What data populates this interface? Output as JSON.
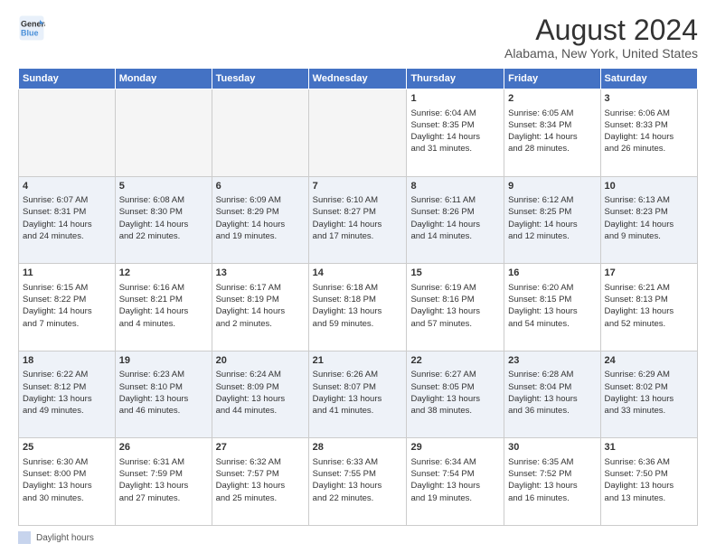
{
  "header": {
    "logo_line1": "General",
    "logo_line2": "Blue",
    "title": "August 2024",
    "subtitle": "Alabama, New York, United States"
  },
  "days_of_week": [
    "Sunday",
    "Monday",
    "Tuesday",
    "Wednesday",
    "Thursday",
    "Friday",
    "Saturday"
  ],
  "footer": {
    "label": "Daylight hours"
  },
  "weeks": [
    {
      "days": [
        {
          "num": "",
          "info": ""
        },
        {
          "num": "",
          "info": ""
        },
        {
          "num": "",
          "info": ""
        },
        {
          "num": "",
          "info": ""
        },
        {
          "num": "1",
          "info": "Sunrise: 6:04 AM\nSunset: 8:35 PM\nDaylight: 14 hours\nand 31 minutes."
        },
        {
          "num": "2",
          "info": "Sunrise: 6:05 AM\nSunset: 8:34 PM\nDaylight: 14 hours\nand 28 minutes."
        },
        {
          "num": "3",
          "info": "Sunrise: 6:06 AM\nSunset: 8:33 PM\nDaylight: 14 hours\nand 26 minutes."
        }
      ]
    },
    {
      "days": [
        {
          "num": "4",
          "info": "Sunrise: 6:07 AM\nSunset: 8:31 PM\nDaylight: 14 hours\nand 24 minutes."
        },
        {
          "num": "5",
          "info": "Sunrise: 6:08 AM\nSunset: 8:30 PM\nDaylight: 14 hours\nand 22 minutes."
        },
        {
          "num": "6",
          "info": "Sunrise: 6:09 AM\nSunset: 8:29 PM\nDaylight: 14 hours\nand 19 minutes."
        },
        {
          "num": "7",
          "info": "Sunrise: 6:10 AM\nSunset: 8:27 PM\nDaylight: 14 hours\nand 17 minutes."
        },
        {
          "num": "8",
          "info": "Sunrise: 6:11 AM\nSunset: 8:26 PM\nDaylight: 14 hours\nand 14 minutes."
        },
        {
          "num": "9",
          "info": "Sunrise: 6:12 AM\nSunset: 8:25 PM\nDaylight: 14 hours\nand 12 minutes."
        },
        {
          "num": "10",
          "info": "Sunrise: 6:13 AM\nSunset: 8:23 PM\nDaylight: 14 hours\nand 9 minutes."
        }
      ]
    },
    {
      "days": [
        {
          "num": "11",
          "info": "Sunrise: 6:15 AM\nSunset: 8:22 PM\nDaylight: 14 hours\nand 7 minutes."
        },
        {
          "num": "12",
          "info": "Sunrise: 6:16 AM\nSunset: 8:21 PM\nDaylight: 14 hours\nand 4 minutes."
        },
        {
          "num": "13",
          "info": "Sunrise: 6:17 AM\nSunset: 8:19 PM\nDaylight: 14 hours\nand 2 minutes."
        },
        {
          "num": "14",
          "info": "Sunrise: 6:18 AM\nSunset: 8:18 PM\nDaylight: 13 hours\nand 59 minutes."
        },
        {
          "num": "15",
          "info": "Sunrise: 6:19 AM\nSunset: 8:16 PM\nDaylight: 13 hours\nand 57 minutes."
        },
        {
          "num": "16",
          "info": "Sunrise: 6:20 AM\nSunset: 8:15 PM\nDaylight: 13 hours\nand 54 minutes."
        },
        {
          "num": "17",
          "info": "Sunrise: 6:21 AM\nSunset: 8:13 PM\nDaylight: 13 hours\nand 52 minutes."
        }
      ]
    },
    {
      "days": [
        {
          "num": "18",
          "info": "Sunrise: 6:22 AM\nSunset: 8:12 PM\nDaylight: 13 hours\nand 49 minutes."
        },
        {
          "num": "19",
          "info": "Sunrise: 6:23 AM\nSunset: 8:10 PM\nDaylight: 13 hours\nand 46 minutes."
        },
        {
          "num": "20",
          "info": "Sunrise: 6:24 AM\nSunset: 8:09 PM\nDaylight: 13 hours\nand 44 minutes."
        },
        {
          "num": "21",
          "info": "Sunrise: 6:26 AM\nSunset: 8:07 PM\nDaylight: 13 hours\nand 41 minutes."
        },
        {
          "num": "22",
          "info": "Sunrise: 6:27 AM\nSunset: 8:05 PM\nDaylight: 13 hours\nand 38 minutes."
        },
        {
          "num": "23",
          "info": "Sunrise: 6:28 AM\nSunset: 8:04 PM\nDaylight: 13 hours\nand 36 minutes."
        },
        {
          "num": "24",
          "info": "Sunrise: 6:29 AM\nSunset: 8:02 PM\nDaylight: 13 hours\nand 33 minutes."
        }
      ]
    },
    {
      "days": [
        {
          "num": "25",
          "info": "Sunrise: 6:30 AM\nSunset: 8:00 PM\nDaylight: 13 hours\nand 30 minutes."
        },
        {
          "num": "26",
          "info": "Sunrise: 6:31 AM\nSunset: 7:59 PM\nDaylight: 13 hours\nand 27 minutes."
        },
        {
          "num": "27",
          "info": "Sunrise: 6:32 AM\nSunset: 7:57 PM\nDaylight: 13 hours\nand 25 minutes."
        },
        {
          "num": "28",
          "info": "Sunrise: 6:33 AM\nSunset: 7:55 PM\nDaylight: 13 hours\nand 22 minutes."
        },
        {
          "num": "29",
          "info": "Sunrise: 6:34 AM\nSunset: 7:54 PM\nDaylight: 13 hours\nand 19 minutes."
        },
        {
          "num": "30",
          "info": "Sunrise: 6:35 AM\nSunset: 7:52 PM\nDaylight: 13 hours\nand 16 minutes."
        },
        {
          "num": "31",
          "info": "Sunrise: 6:36 AM\nSunset: 7:50 PM\nDaylight: 13 hours\nand 13 minutes."
        }
      ]
    }
  ]
}
